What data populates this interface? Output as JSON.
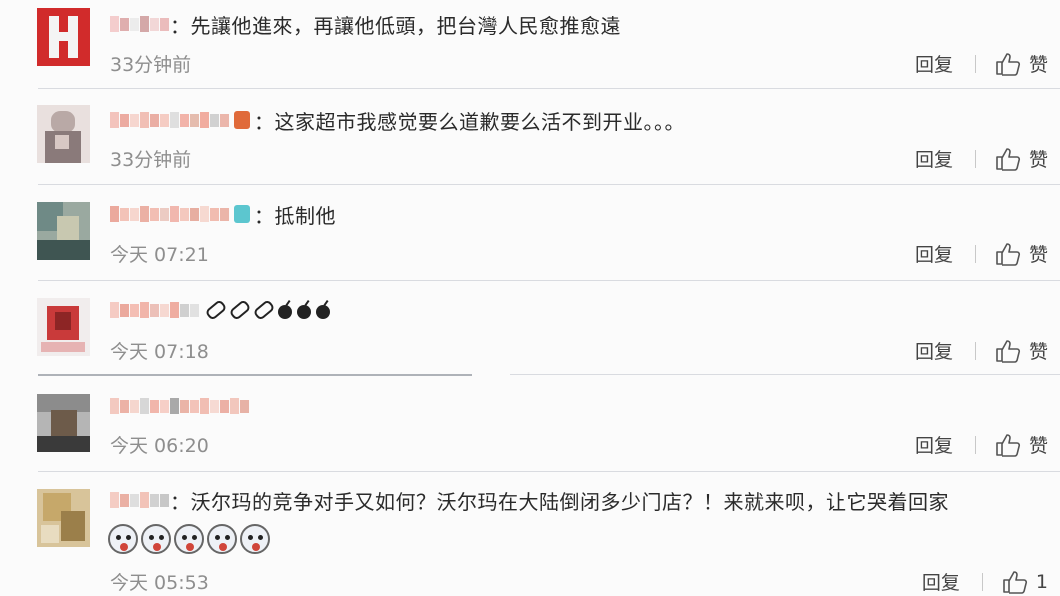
{
  "comments": [
    {
      "avatar_colors": [
        "#d12b2b",
        "#f4f4f4",
        "#c21f1f",
        "#f7d9d9"
      ],
      "nick_colors": [
        "#f2c4c4",
        "#d9a0a0",
        "#e9e9e9",
        "#c99",
        "#f0d0d0",
        "#e8b0b0"
      ],
      "text": "：先讓他進來，再讓他低頭，把台灣人民愈推愈遠",
      "time": "33分钟前",
      "reply": "回复",
      "like": "赞"
    },
    {
      "avatar_colors": [
        "#b9a9a6",
        "#d8c8c4",
        "#8a7a7a",
        "#e9e0de"
      ],
      "nick_colors": [
        "#f1b8b0",
        "#e99c90",
        "#f5cfc7",
        "#efb4a8",
        "#e6a094",
        "#f3c3b8",
        "#d9d9d9",
        "#f0a69a",
        "#e0b0a0",
        "#ee9e8e",
        "#c9c9c9",
        "#e7a99c"
      ],
      "badge_color": "#e06a3a",
      "text": "：这家超市我感觉要么道歉要么活不到开业。。。",
      "time": "33分钟前",
      "reply": "回复",
      "like": "赞"
    },
    {
      "avatar_colors": [
        "#6f8a86",
        "#c8c8b0",
        "#3f5552",
        "#9aa9a0"
      ],
      "nick_colors": [
        "#e89a8c",
        "#f1b8ac",
        "#f4cfc6",
        "#e7a294",
        "#f0b3a6",
        "#e9c2b8",
        "#eeaaa0",
        "#f2beb3",
        "#e3a091",
        "#f5d2c9",
        "#eeb0a2",
        "#e8a89a"
      ],
      "badge_color": "#5cc6cf",
      "text": "：抵制他",
      "time": "今天 07:21",
      "reply": "回复",
      "like": "赞"
    },
    {
      "avatar_colors": [
        "#c93a3a",
        "#f1eded",
        "#8d2525",
        "#e6b3b3"
      ],
      "nick_colors": [
        "#f3c2b8",
        "#e79a8c",
        "#f2b3a7",
        "#efa89b",
        "#e9b5ab",
        "#f5d1c9",
        "#ec9f91",
        "#c8c8c8",
        "#dcdcdc"
      ],
      "emoji": "pills-bombs",
      "time": "今天 07:18",
      "reply": "回复",
      "like": "赞"
    },
    {
      "avatar_colors": [
        "#8c8c8c",
        "#3a3a3a",
        "#6d5b4a",
        "#b5b5b5"
      ],
      "nick_colors": [
        "#f1c0b5",
        "#e9a597",
        "#f3cfc6",
        "#d0d0d0",
        "#eea99c",
        "#f4c7bd",
        "#9a9a9a",
        "#e6a798",
        "#f1b9ad",
        "#eeb3a6",
        "#f5d3cb",
        "#e9a295",
        "#f0bdb1",
        "#e3a496"
      ],
      "text": "",
      "time": "今天 06:20",
      "reply": "回复",
      "like": "赞"
    },
    {
      "avatar_colors": [
        "#c6a86a",
        "#e8dcc0",
        "#9b7f4a",
        "#d8c49a"
      ],
      "nick_colors": [
        "#f2c3b9",
        "#e6a294",
        "#d8d8d8",
        "#f0b8ac",
        "#c9c9c9",
        "#bdbdbd"
      ],
      "text": "：沃尔玛的竞争对手又如何？沃尔玛在大陆倒闭多少门店？！来就来呗，让它哭着回家",
      "time": "今天 05:53",
      "reply": "回复",
      "like_count": "1"
    }
  ],
  "colors": {
    "divider": "#d9dbe0",
    "time": "#8e8e8e",
    "action": "#444444"
  }
}
